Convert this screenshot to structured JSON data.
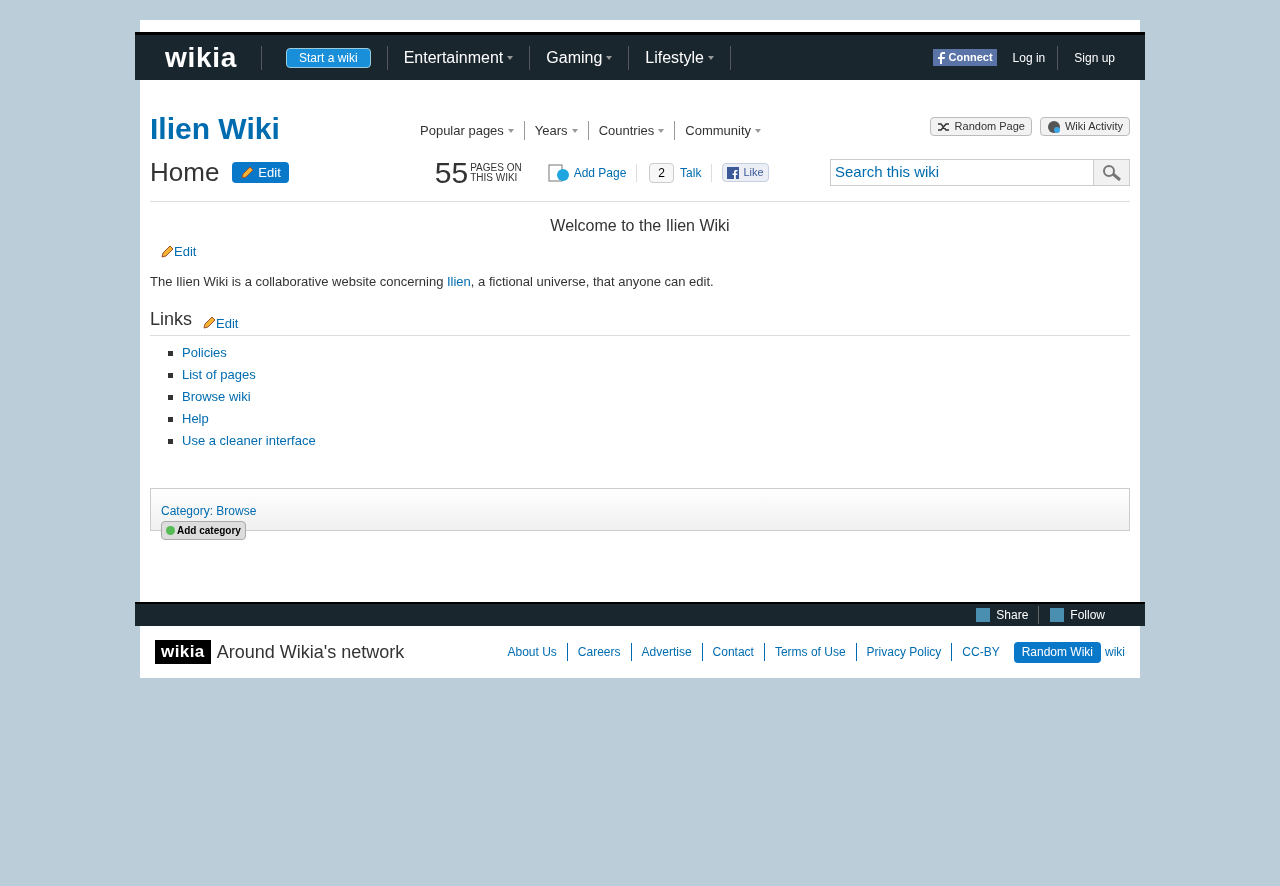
{
  "global_nav": {
    "logo": "wikia",
    "start_button": "Start a wiki",
    "hubs": [
      "Entertainment",
      "Gaming",
      "Lifestyle"
    ],
    "connect": "Connect",
    "login": "Log in",
    "signup": "Sign up"
  },
  "wiki_header": {
    "title": "Ilien Wiki",
    "menu": [
      "Popular pages",
      "Years",
      "Countries",
      "Community"
    ],
    "buttons": [
      {
        "kind": "random",
        "label": "Random Page"
      },
      {
        "kind": "activity",
        "label": "Wiki Activity"
      }
    ]
  },
  "page_header": {
    "title": "Home",
    "edit": "Edit",
    "count": "55",
    "count_label_1": "PAGES ON",
    "count_label_2": "THIS WIKI",
    "add_page": "Add Page",
    "talk_count": "2",
    "talk": "Talk",
    "like": "Like",
    "search_placeholder": "Search this wiki"
  },
  "article": {
    "heading": "Welcome to the Ilien Wiki",
    "edit": "Edit",
    "intro_before": "The Ilien Wiki is a collaborative website concerning ",
    "intro_link": "Ilien",
    "intro_after": ", a fictional universe, that anyone can edit.",
    "section": "Links",
    "section_edit": "Edit",
    "links": [
      "Policies",
      "List of pages",
      "Browse wiki",
      "Help",
      "Use a cleaner interface"
    ]
  },
  "categories": {
    "label": "Category: Browse",
    "add": "Add category"
  },
  "toolbar": {
    "share": "Share",
    "follow": "Follow"
  },
  "footer": {
    "logo": "wikia",
    "network": "Around Wikia's network",
    "links": [
      "About Us",
      "Careers",
      "Advertise",
      "Contact",
      "Terms of Use",
      "Privacy Policy",
      "CC-BY"
    ],
    "random": "Random Wiki",
    "tail": "wiki"
  }
}
